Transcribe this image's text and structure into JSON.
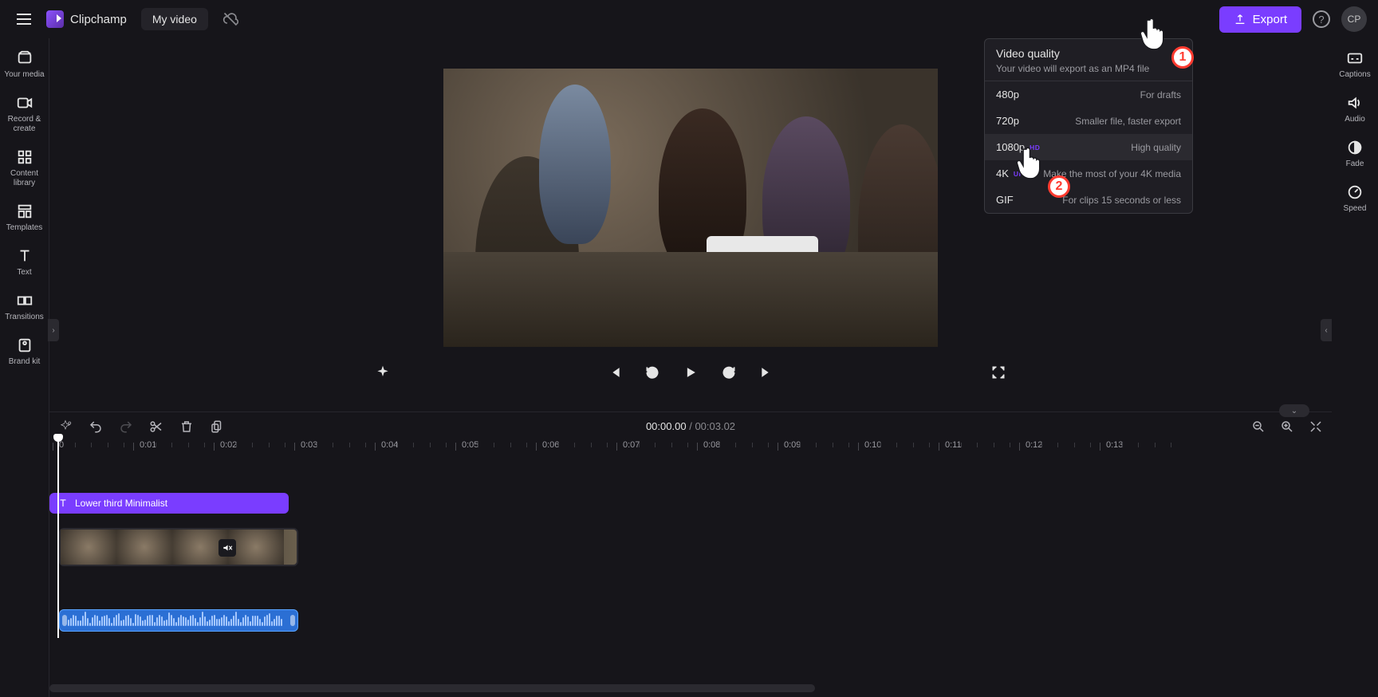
{
  "brand": "Clipchamp",
  "project_title": "My video",
  "export_button": "Export",
  "avatar_initials": "CP",
  "left_nav": [
    {
      "id": "your-media",
      "label": "Your media"
    },
    {
      "id": "record-create",
      "label": "Record & create"
    },
    {
      "id": "content-library",
      "label": "Content library"
    },
    {
      "id": "templates",
      "label": "Templates"
    },
    {
      "id": "text",
      "label": "Text"
    },
    {
      "id": "transitions",
      "label": "Transitions"
    },
    {
      "id": "brand-kit",
      "label": "Brand kit"
    }
  ],
  "right_nav": [
    {
      "id": "captions",
      "label": "Captions"
    },
    {
      "id": "audio",
      "label": "Audio"
    },
    {
      "id": "fade",
      "label": "Fade"
    },
    {
      "id": "speed",
      "label": "Speed"
    }
  ],
  "playback": {
    "back_seconds": "5",
    "forward_seconds": "5"
  },
  "time": {
    "current": "00:00.00",
    "separator": "/",
    "duration": "00:03.02"
  },
  "ruler": [
    "0",
    "0:01",
    "0:02",
    "0:03",
    "0:04",
    "0:05",
    "0:06",
    "0:07",
    "0:08",
    "0:09",
    "0:10",
    "0:11",
    "0:12",
    "0:13"
  ],
  "clips": {
    "text_label": "Lower third Minimalist"
  },
  "export_popover": {
    "title": "Video quality",
    "subtitle": "Your video will export as an MP4 file",
    "options": [
      {
        "label": "480p",
        "badge": "",
        "desc": "For drafts",
        "selected": false
      },
      {
        "label": "720p",
        "badge": "",
        "desc": "Smaller file, faster export",
        "selected": false
      },
      {
        "label": "1080p",
        "badge": "HD",
        "desc": "High quality",
        "selected": true
      },
      {
        "label": "4K",
        "badge": "UHD",
        "desc": "Make the most of your 4K media",
        "selected": false
      },
      {
        "label": "GIF",
        "badge": "",
        "desc": "For clips 15 seconds or less",
        "selected": false
      }
    ]
  },
  "annotations": {
    "step1": "1",
    "step2": "2"
  }
}
